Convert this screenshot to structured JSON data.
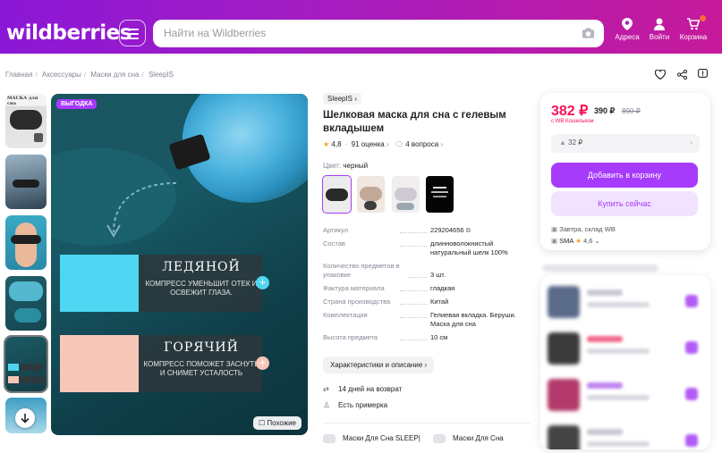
{
  "header": {
    "logo": "wildberries",
    "search_placeholder": "Найти на Wildberries",
    "nav": [
      "Адреса",
      "Войти",
      "Корзина"
    ]
  },
  "breadcrumbs": [
    "Главная",
    "Аксессуары",
    "Маски для сна",
    "SleepIS"
  ],
  "gallery": {
    "promo_label": "ВЫГОДКА",
    "panel1_title": "ЛЕДЯНОЙ",
    "panel1_text": "КОМПРЕСС УМЕНЬШИТ ОТЕК И ОСВЕЖИТ ГЛАЗА.",
    "panel2_title": "ГОРЯЧИЙ",
    "panel2_text": "КОМПРЕСС ПОМОЖЕТ ЗАСНУТЬ И СНИМЕТ УСТАЛОСТЬ",
    "similar_label": "Похожие",
    "thumb_caption": "МАСКА для сна"
  },
  "product": {
    "brand": "SleepIS",
    "title": "Шелковая маска для сна с гелевым вкладышем",
    "rating": "4,8",
    "reviews": "91 оценка",
    "questions": "4 вопроса",
    "color_label": "Цвет:",
    "color_value": "черный",
    "specs": [
      {
        "k": "Артикул",
        "v": "229204656"
      },
      {
        "k": "Состав",
        "v": "длинноволокнистый натуральный шелк 100%"
      },
      {
        "k": "Количество предметов в упаковке",
        "v": "3 шт."
      },
      {
        "k": "Фактура материала",
        "v": "гладкая"
      },
      {
        "k": "Страна производства",
        "v": "Китай"
      },
      {
        "k": "Комплектация",
        "v": "Гелиевая вкладка. Беруши. Маска для сна"
      },
      {
        "k": "Высота предмета",
        "v": "10 см"
      }
    ],
    "chars_button": "Характеристики и описание",
    "return_text": "14 дней на возврат",
    "fitting_text": "Есть примерка",
    "tag1": "Маски Для Сна SLEEP|",
    "tag2": "Маски Для Сна"
  },
  "buy": {
    "price": "382 ₽",
    "price_no_wallet": "390 ₽",
    "old_price": "890 ₽",
    "wallet_note": "с WB Кошельком",
    "cashback": "32 ₽",
    "add_to_cart": "Добавить в корзину",
    "buy_now": "Купить сейчас",
    "delivery": "Завтра, склад WB",
    "seller": "SMA",
    "seller_rating": "4,6"
  },
  "colors": {
    "accent": "#a63bfb",
    "price": "#f91155",
    "header_start": "#8b17d6",
    "header_end": "#c61a9a"
  }
}
